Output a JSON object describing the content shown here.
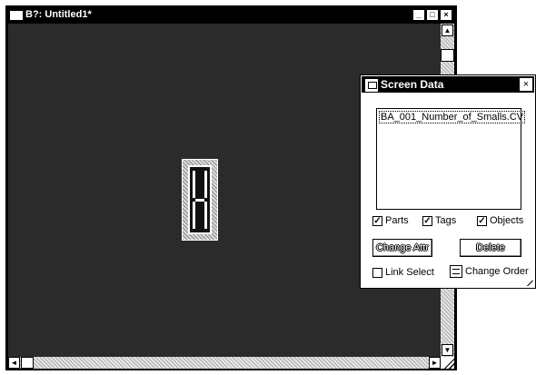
{
  "window": {
    "title": "B?: Untitled1*",
    "minimize_glyph": "_",
    "maximize_glyph": "□",
    "close_glyph": "×"
  },
  "scrollbars": {
    "up_glyph": "▲",
    "down_glyph": "▼",
    "left_glyph": "◄",
    "right_glyph": "►"
  },
  "dialog": {
    "title": "Screen Data",
    "close_glyph": "×",
    "list_items": [
      "BA_001_Number_of_Smalls.CV"
    ],
    "checkboxes": {
      "parts": {
        "label": "Parts",
        "checked": true
      },
      "tags": {
        "label": "Tags",
        "checked": true
      },
      "objects": {
        "label": "Objects",
        "checked": true
      }
    },
    "change_attr_label": "Change Attr",
    "delete_label": "Delete",
    "link_select": {
      "label": "Link Select",
      "checked": false
    },
    "change_order_label": "Change Order",
    "check_glyph": "✓"
  },
  "icons": {
    "window_icon": "window-icon",
    "dialog_icon": "screen-data-icon",
    "change_order_icon": "change-order-icon"
  },
  "colors": {
    "canvas": "#2b2b2b",
    "titlebar": "#000000"
  }
}
